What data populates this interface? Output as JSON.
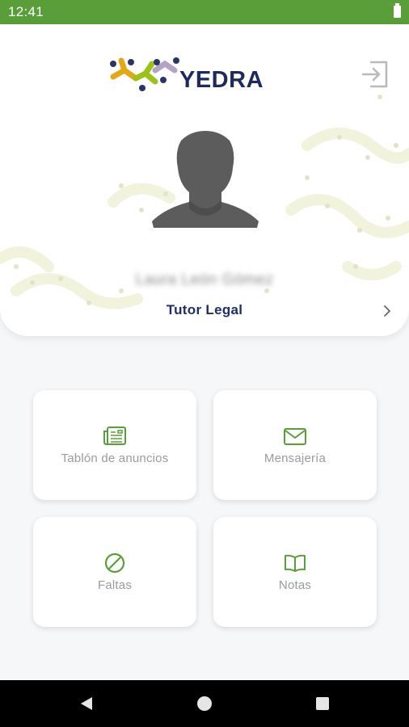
{
  "status_bar": {
    "time": "12:41"
  },
  "header": {
    "logo_text": "YEDRA",
    "user_name": "Laura León Gómez",
    "role": "Tutor Legal"
  },
  "tiles": [
    {
      "label": "Tablón de anuncios",
      "icon": "newspaper-icon"
    },
    {
      "label": "Mensajería",
      "icon": "envelope-icon"
    },
    {
      "label": "Faltas",
      "icon": "prohibited-icon"
    },
    {
      "label": "Notas",
      "icon": "open-book-icon"
    }
  ],
  "colors": {
    "status_bar": "#5a9e3a",
    "accent_green": "#5a9e3a",
    "role_text": "#1d2f6a",
    "logo_text": "#1d2a5e",
    "tile_label": "#9b9b9b"
  }
}
